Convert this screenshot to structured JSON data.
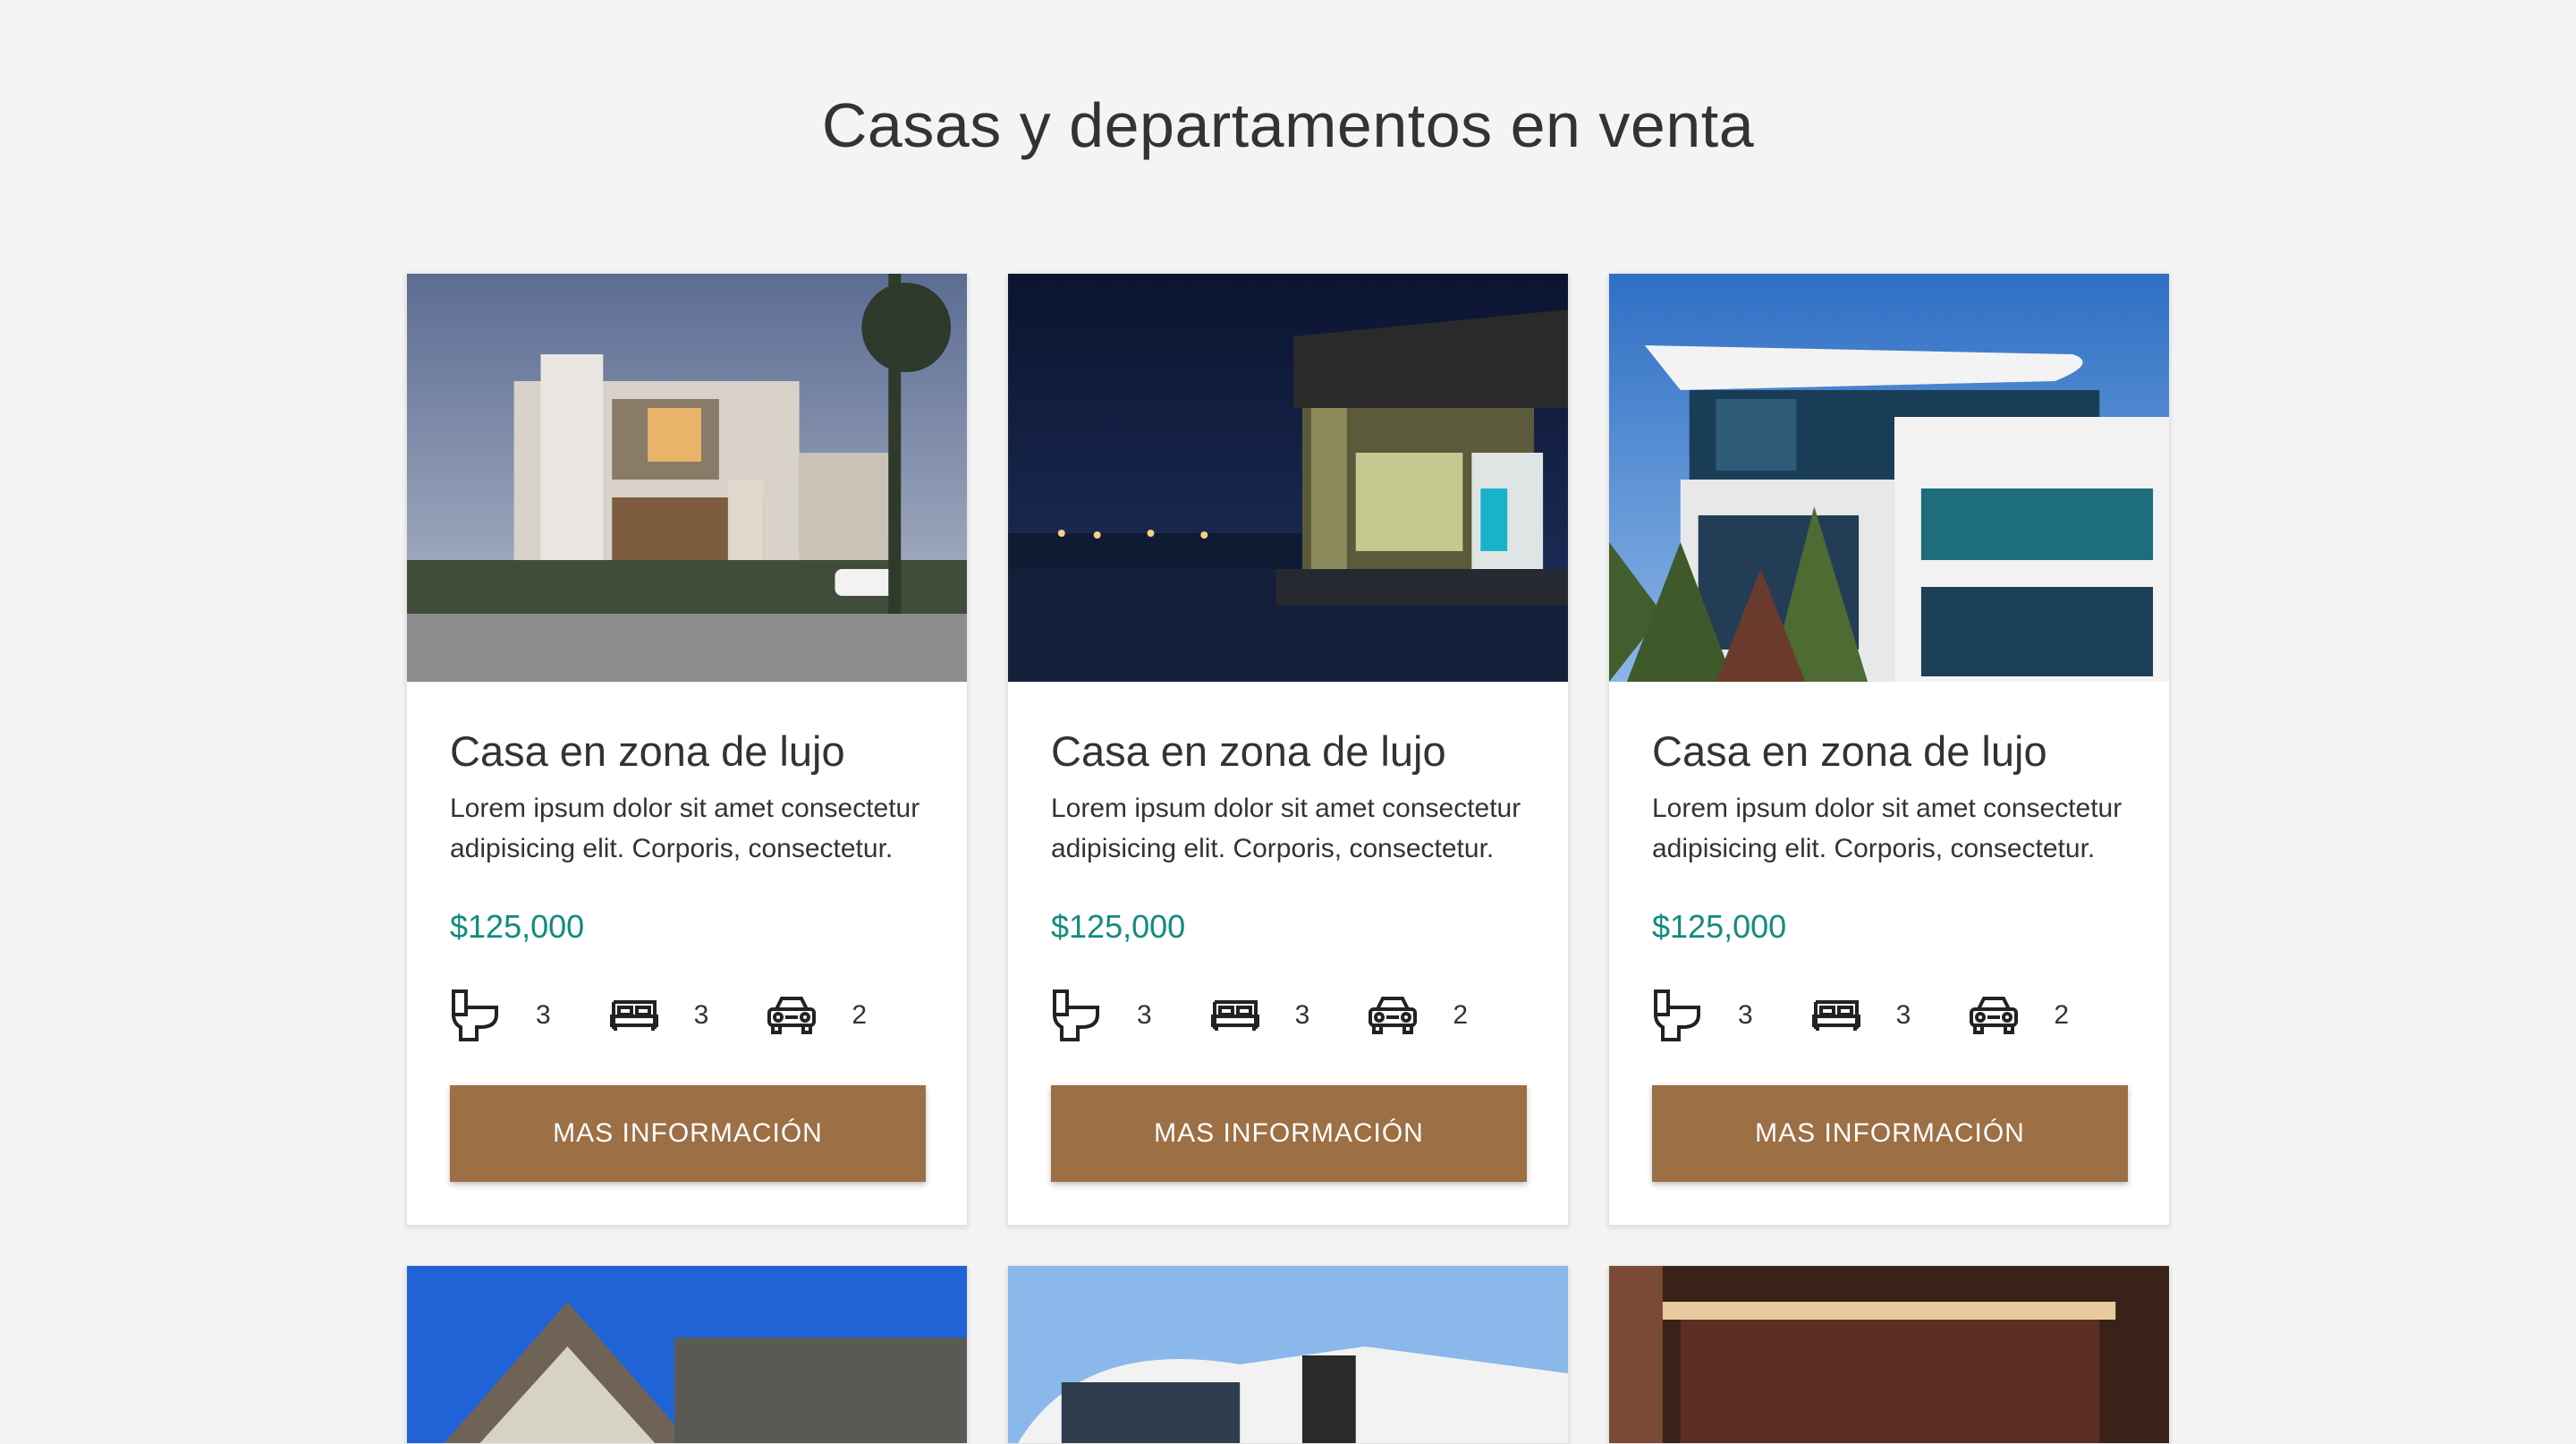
{
  "page": {
    "title": "Casas y departamentos en venta"
  },
  "listings": [
    {
      "title": "Casa en zona de lujo",
      "description": "Lorem ipsum dolor sit amet consectetur adipisicing elit. Corporis, consectetur.",
      "price": "$125,000",
      "bathrooms": "3",
      "bedrooms": "3",
      "parking": "2",
      "button_label": "MAS INFORMACIÓN"
    },
    {
      "title": "Casa en zona de lujo",
      "description": "Lorem ipsum dolor sit amet consectetur adipisicing elit. Corporis, consectetur.",
      "price": "$125,000",
      "bathrooms": "3",
      "bedrooms": "3",
      "parking": "2",
      "button_label": "MAS INFORMACIÓN"
    },
    {
      "title": "Casa en zona de lujo",
      "description": "Lorem ipsum dolor sit amet consectetur adipisicing elit. Corporis, consectetur.",
      "price": "$125,000",
      "bathrooms": "3",
      "bedrooms": "3",
      "parking": "2",
      "button_label": "MAS INFORMACIÓN"
    }
  ],
  "colors": {
    "background": "#f4f4f4",
    "price": "#138a80",
    "button": "#9c6f45"
  },
  "icons": [
    "toilet-icon",
    "bed-icon",
    "car-icon"
  ]
}
